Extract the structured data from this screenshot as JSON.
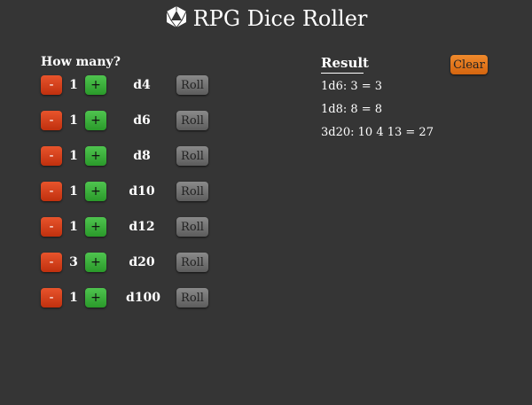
{
  "app": {
    "title": "RPG Dice Roller",
    "icon": "d20-icon"
  },
  "dice_panel": {
    "heading": "How many?",
    "minus_label": "-",
    "plus_label": "+",
    "roll_label": "Roll",
    "rows": [
      {
        "count": "1",
        "die": "d4"
      },
      {
        "count": "1",
        "die": "d6"
      },
      {
        "count": "1",
        "die": "d8"
      },
      {
        "count": "1",
        "die": "d10"
      },
      {
        "count": "1",
        "die": "d12"
      },
      {
        "count": "3",
        "die": "d20"
      },
      {
        "count": "1",
        "die": "d100"
      }
    ]
  },
  "results": {
    "heading": "Result",
    "clear_label": "Clear",
    "lines": [
      "1d6: 3 = 3",
      "1d8: 8 = 8",
      "3d20: 10 4 13 = 27"
    ]
  },
  "colors": {
    "background": "#353535",
    "minus": "#d8401c",
    "plus": "#3cb43c",
    "roll": "#777777",
    "clear": "#e67a1e"
  }
}
